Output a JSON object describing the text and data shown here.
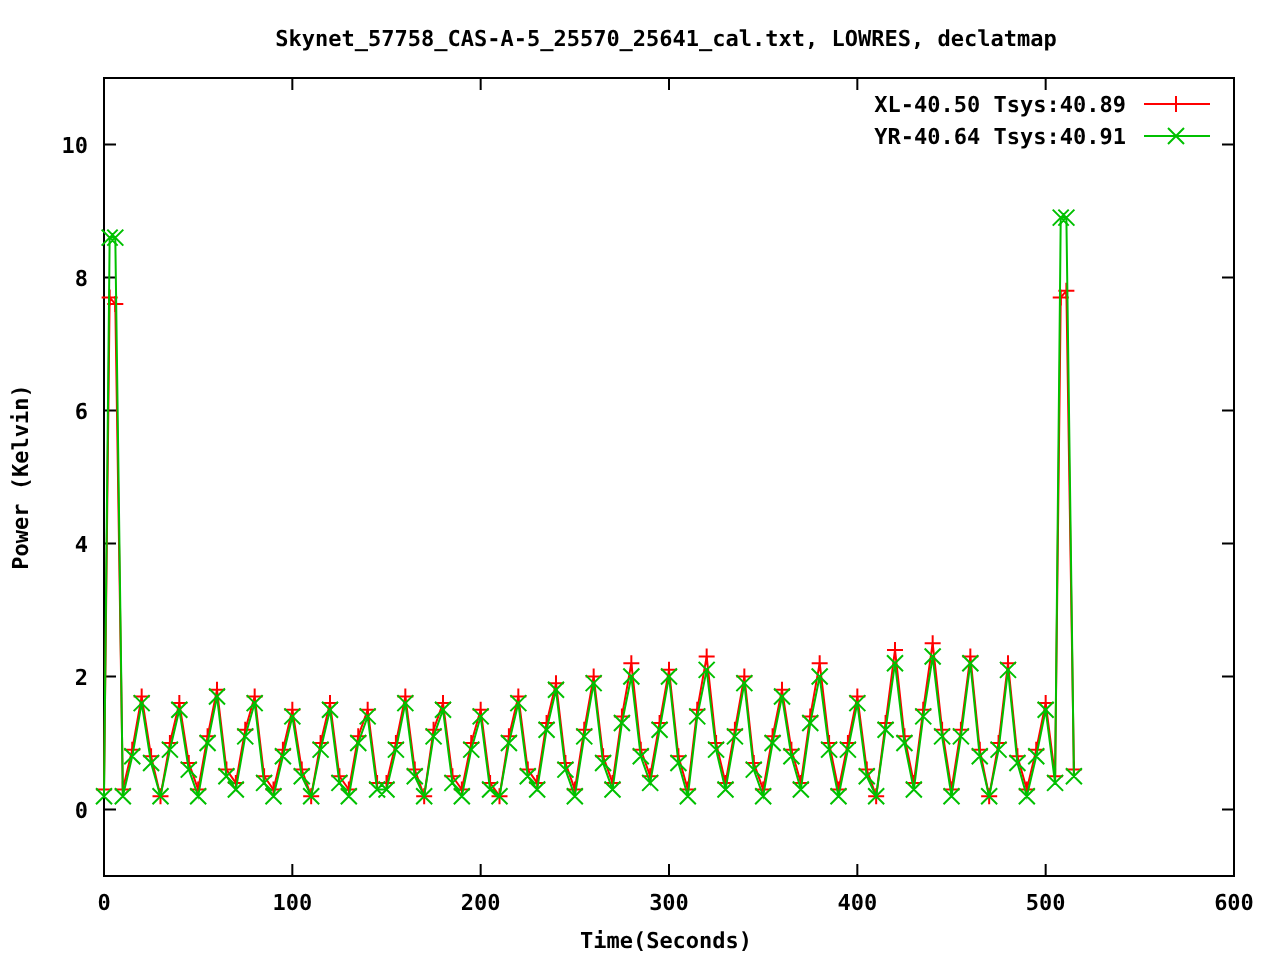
{
  "chart_data": {
    "type": "line",
    "title": "Skynet_57758_CAS-A-5_25570_25641_cal.txt, LOWRES, declatmap",
    "xlabel": "Time(Seconds)",
    "ylabel": "Power (Kelvin)",
    "xlim": [
      0,
      600
    ],
    "ylim": [
      -1,
      11
    ],
    "xticks": [
      0,
      100,
      200,
      300,
      400,
      500,
      600
    ],
    "yticks": [
      0,
      2,
      4,
      6,
      8,
      10
    ],
    "legend": true,
    "x": [
      0,
      3,
      6,
      10,
      15,
      20,
      25,
      30,
      35,
      40,
      45,
      50,
      55,
      60,
      65,
      70,
      75,
      80,
      85,
      90,
      95,
      100,
      105,
      110,
      115,
      120,
      125,
      130,
      135,
      140,
      145,
      150,
      155,
      160,
      165,
      170,
      175,
      180,
      185,
      190,
      195,
      200,
      205,
      210,
      215,
      220,
      225,
      230,
      235,
      240,
      245,
      250,
      255,
      260,
      265,
      270,
      275,
      280,
      285,
      290,
      295,
      300,
      305,
      310,
      315,
      320,
      325,
      330,
      335,
      340,
      345,
      350,
      355,
      360,
      365,
      370,
      375,
      380,
      385,
      390,
      395,
      400,
      405,
      410,
      415,
      420,
      425,
      430,
      435,
      440,
      445,
      450,
      455,
      460,
      465,
      470,
      475,
      480,
      485,
      490,
      495,
      500,
      505,
      508,
      511,
      515
    ],
    "series": [
      {
        "name": "XL-40.50 Tsys:40.89",
        "color": "#ff0000",
        "marker": "plus",
        "values": [
          0.3,
          7.7,
          7.6,
          0.3,
          0.9,
          1.7,
          0.8,
          0.2,
          1.0,
          1.6,
          0.7,
          0.3,
          1.1,
          1.8,
          0.6,
          0.4,
          1.2,
          1.7,
          0.5,
          0.3,
          0.9,
          1.5,
          0.6,
          0.2,
          1.0,
          1.6,
          0.5,
          0.3,
          1.1,
          1.5,
          0.4,
          0.4,
          1.0,
          1.7,
          0.6,
          0.2,
          1.2,
          1.6,
          0.5,
          0.3,
          1.0,
          1.5,
          0.4,
          0.2,
          1.1,
          1.7,
          0.6,
          0.4,
          1.3,
          1.9,
          0.7,
          0.3,
          1.2,
          2.0,
          0.8,
          0.4,
          1.4,
          2.2,
          0.9,
          0.5,
          1.3,
          2.1,
          0.8,
          0.3,
          1.5,
          2.3,
          1.0,
          0.4,
          1.2,
          2.0,
          0.7,
          0.3,
          1.1,
          1.8,
          0.9,
          0.4,
          1.4,
          2.2,
          1.0,
          0.3,
          1.0,
          1.7,
          0.6,
          0.2,
          1.3,
          2.4,
          1.1,
          0.4,
          1.5,
          2.5,
          1.2,
          0.3,
          1.2,
          2.3,
          0.9,
          0.2,
          1.0,
          2.2,
          0.8,
          0.3,
          0.9,
          1.6,
          0.5,
          7.7,
          7.8,
          0.6
        ]
      },
      {
        "name": "YR-40.64 Tsys:40.91",
        "color": "#00c000",
        "marker": "cross",
        "values": [
          0.2,
          8.6,
          8.6,
          0.2,
          0.8,
          1.6,
          0.7,
          0.2,
          0.9,
          1.5,
          0.6,
          0.2,
          1.0,
          1.7,
          0.5,
          0.3,
          1.1,
          1.6,
          0.4,
          0.2,
          0.8,
          1.4,
          0.5,
          0.2,
          0.9,
          1.5,
          0.4,
          0.2,
          1.0,
          1.4,
          0.3,
          0.3,
          0.9,
          1.6,
          0.5,
          0.2,
          1.1,
          1.5,
          0.4,
          0.2,
          0.9,
          1.4,
          0.3,
          0.2,
          1.0,
          1.6,
          0.5,
          0.3,
          1.2,
          1.8,
          0.6,
          0.2,
          1.1,
          1.9,
          0.7,
          0.3,
          1.3,
          2.0,
          0.8,
          0.4,
          1.2,
          2.0,
          0.7,
          0.2,
          1.4,
          2.1,
          0.9,
          0.3,
          1.1,
          1.9,
          0.6,
          0.2,
          1.0,
          1.7,
          0.8,
          0.3,
          1.3,
          2.0,
          0.9,
          0.2,
          0.9,
          1.6,
          0.5,
          0.2,
          1.2,
          2.2,
          1.0,
          0.3,
          1.4,
          2.3,
          1.1,
          0.2,
          1.1,
          2.2,
          0.8,
          0.2,
          0.9,
          2.1,
          0.7,
          0.2,
          0.8,
          1.5,
          0.4,
          8.9,
          8.9,
          0.5
        ]
      }
    ]
  }
}
